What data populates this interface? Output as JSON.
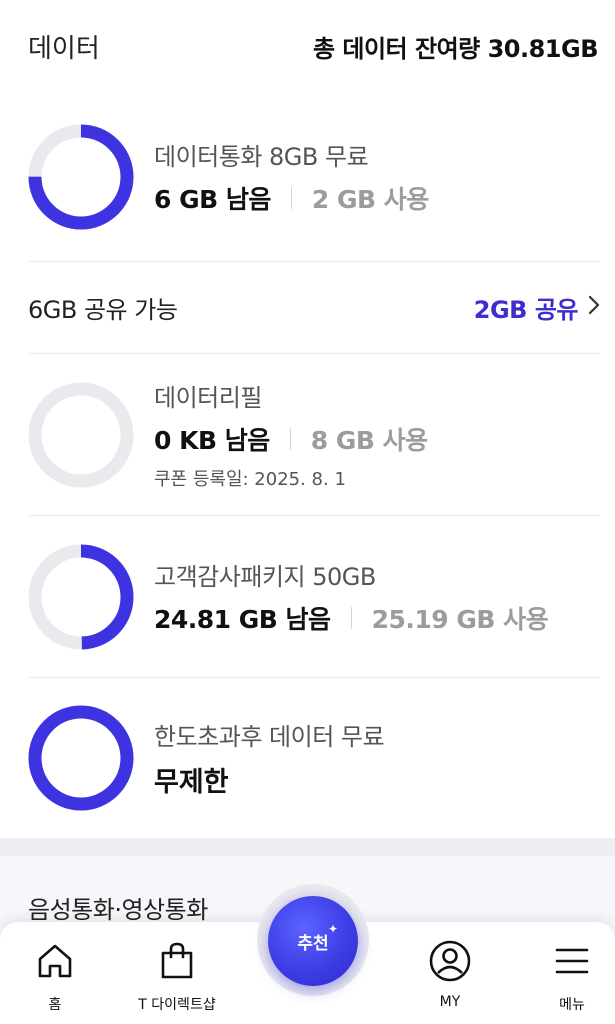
{
  "header": {
    "title": "데이터",
    "total_remaining": "총 데이터 잔여량 30.81GB"
  },
  "colors": {
    "accent": "#3d2fcf",
    "ring_track": "#ebe9ee",
    "ring_fill": "#3d33e0",
    "used_text": "#9c9c9c"
  },
  "plans": [
    {
      "name": "데이터통화 8GB 무료",
      "remaining": "6 GB 남음",
      "used": "2 GB 사용",
      "remaining_fraction": 0.75
    },
    {
      "name": "데이터리필",
      "remaining": "0 KB 남음",
      "used": "8 GB 사용",
      "coupon": "쿠폰 등록일: 2025. 8. 1",
      "remaining_fraction": 0
    },
    {
      "name": "고객감사패키지 50GB",
      "remaining": "24.81 GB 남음",
      "used": "25.19 GB 사용",
      "remaining_fraction": 0.4962
    },
    {
      "name": "한도초과후 데이터 무료",
      "unlimited": "무제한",
      "remaining_fraction": 1
    }
  ],
  "share": {
    "available": "6GB 공유 가능",
    "link": "2GB 공유",
    "chevron_icon": "chevron-right-icon"
  },
  "voice_section": {
    "title": "음성통화·영상통화"
  },
  "bottom_nav": {
    "home": {
      "label": "홈",
      "icon": "home-icon"
    },
    "direct_shop": {
      "label": "T 다이렉트샵",
      "icon": "shopping-bag-icon"
    },
    "recommend": {
      "label": "추천",
      "icon": "sparkle-icon"
    },
    "my": {
      "label": "MY",
      "icon": "user-circle-icon"
    },
    "menu": {
      "label": "메뉴",
      "icon": "hamburger-menu-icon"
    }
  }
}
